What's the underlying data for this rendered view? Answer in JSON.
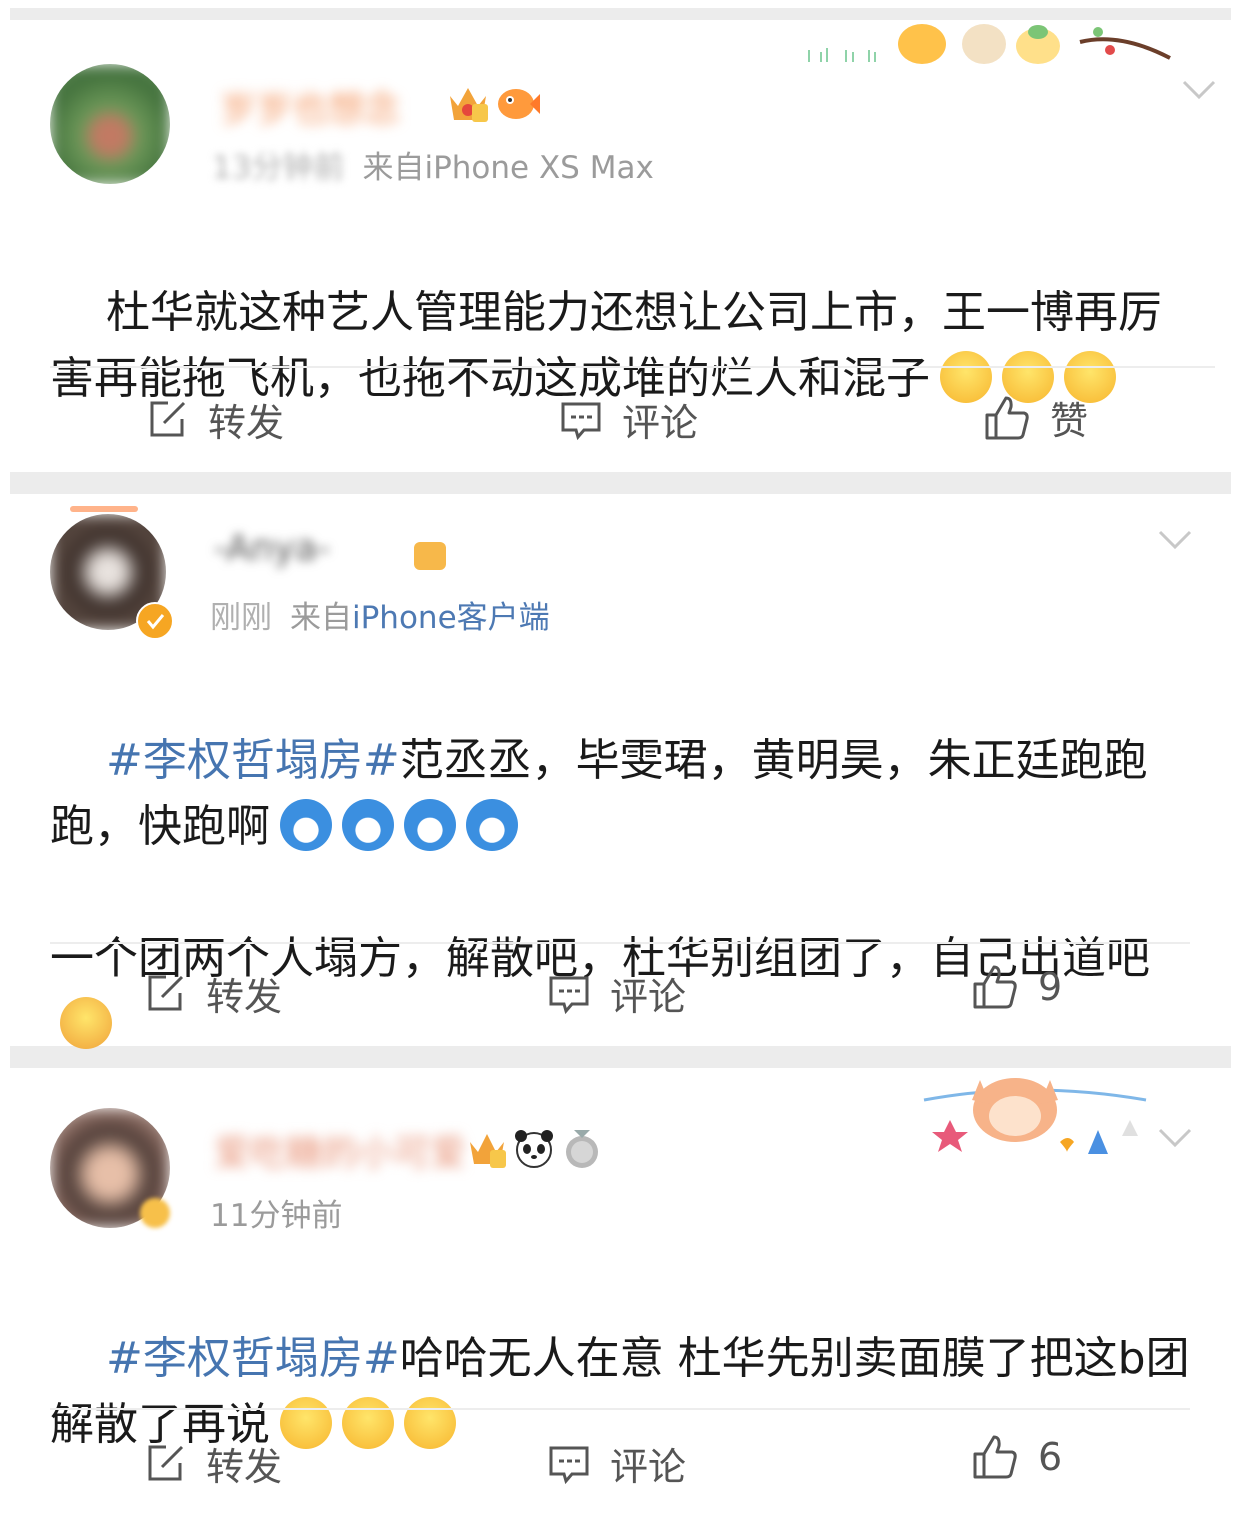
{
  "posts": [
    {
      "username": "岁岁也想念",
      "time": "13分钟前",
      "source_prefix": "来自",
      "source_app": "iPhone XS Max",
      "text": "杜华就这种艺人管理能力还想让公司上市，王一博再厉害再能拖飞机，也拖不动这成堆的烂人和混子",
      "emoji_count": 3,
      "emoji_name": "pray-emoji",
      "actions": {
        "repost": "转发",
        "comment": "评论",
        "like": "赞"
      }
    },
    {
      "username": "-Anya-",
      "time": "刚刚",
      "source_prefix": "来自",
      "source_app": "iPhone客户端",
      "topic": "#李权哲塌房#",
      "text_line1": "范丞丞，毕雯珺，黄明昊，朱正廷跑跑跑，快跑啊",
      "text_line2": "一个团两个人塌方，解散吧，杜华别组团了，自己出道吧",
      "actions": {
        "repost": "转发",
        "comment": "评论",
        "like": "9"
      }
    },
    {
      "username": "爱吃糖的小可爱",
      "time": "11分钟前",
      "topic": "#李权哲塌房#",
      "text": "哈哈无人在意 杜华先别卖面膜了把这b团解散了再说",
      "actions": {
        "repost": "转发",
        "comment": "评论",
        "like": "6"
      }
    }
  ],
  "colors": {
    "topic": "#4675b0",
    "meta": "#9b9b9b",
    "separator": "#ececec",
    "action": "#555555"
  }
}
